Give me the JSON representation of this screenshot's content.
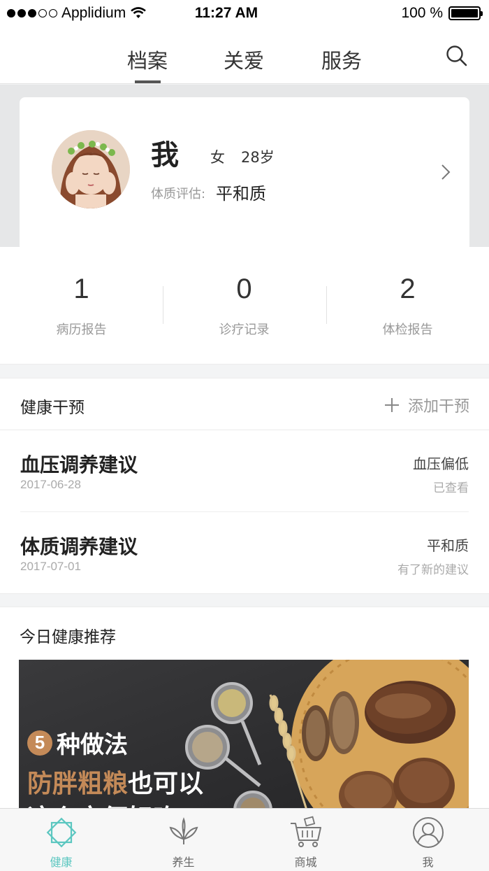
{
  "status_bar": {
    "carrier": "Applidium",
    "time": "11:27 AM",
    "battery": "100 %"
  },
  "top_nav": {
    "tabs": [
      {
        "label": "档案"
      },
      {
        "label": "关爱"
      },
      {
        "label": "服务"
      }
    ],
    "active_tab": 0
  },
  "profile": {
    "name": "我",
    "gender": "女",
    "age": "28岁",
    "constitution_label": "体质评估:",
    "constitution_value": "平和质"
  },
  "stats": [
    {
      "count": "1",
      "label": "病历报告"
    },
    {
      "count": "0",
      "label": "诊疗记录"
    },
    {
      "count": "2",
      "label": "体检报告"
    }
  ],
  "health_intervention": {
    "title": "健康干预",
    "add_label": "添加干预",
    "items": [
      {
        "title": "血压调养建议",
        "date": "2017-06-28",
        "status": "血压偏低",
        "note": "已查看"
      },
      {
        "title": "体质调养建议",
        "date": "2017-07-01",
        "status": "平和质",
        "note": "有了新的建议"
      }
    ]
  },
  "recommendation": {
    "title": "今日健康推荐",
    "banner": {
      "number": "5",
      "line1": "种做法",
      "line2_accent": "防胖粗粮",
      "line2_rest": "也可以",
      "line3": "这么方便好吃!"
    }
  },
  "tab_bar": {
    "active": 0,
    "items": [
      {
        "label": "健康",
        "icon": "health-icon"
      },
      {
        "label": "养生",
        "icon": "leaf-icon"
      },
      {
        "label": "商城",
        "icon": "cart-icon"
      },
      {
        "label": "我",
        "icon": "profile-icon"
      }
    ]
  },
  "colors": {
    "accent": "#5cc7c0",
    "banner_accent": "#c48a58"
  }
}
